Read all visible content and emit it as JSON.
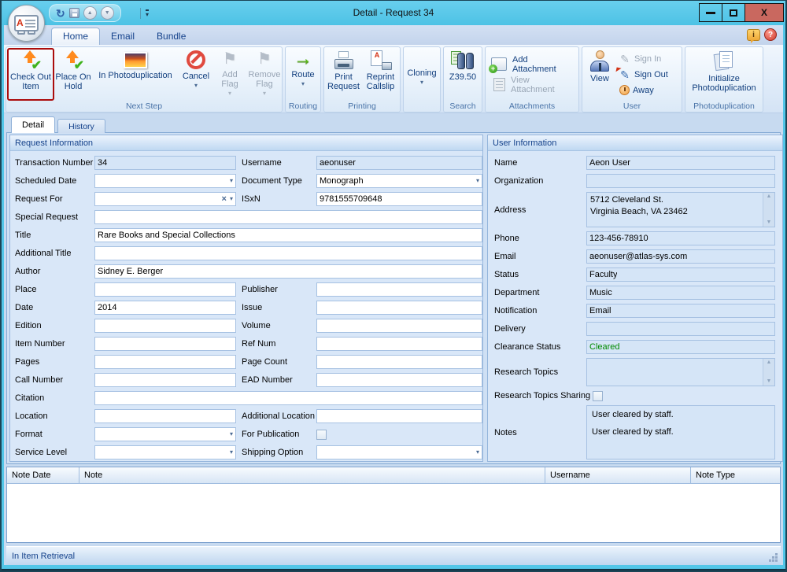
{
  "titlebar": {
    "title": "Detail - Request 34"
  },
  "icons": {
    "dropdown": "▾",
    "clear": "×",
    "check": "✔",
    "flag": "⚑",
    "route_arrow": "→",
    "pencil": "✎",
    "sync": "↻",
    "up": "▲",
    "down": "▼",
    "info": "i",
    "help": "?",
    "close": "X",
    "letter_a": "A",
    "plus": "+"
  },
  "ribbon_tabs": {
    "home": "Home",
    "email": "Email",
    "bundle": "Bundle"
  },
  "ribbon": {
    "next_step": {
      "label": "Next Step",
      "check_out": "Check Out Item",
      "place_hold": "Place On Hold",
      "in_photodup": "In Photoduplication",
      "cancel": "Cancel",
      "add_flag": "Add Flag",
      "remove_flag": "Remove Flag"
    },
    "routing": {
      "label": "Routing",
      "route": "Route"
    },
    "printing": {
      "label": "Printing",
      "print_request": "Print Request",
      "reprint_callslip": "Reprint Callslip"
    },
    "cloning": {
      "label": "",
      "cloning": "Cloning"
    },
    "search": {
      "label": "Search",
      "z3950": "Z39.50"
    },
    "attachments": {
      "label": "Attachments",
      "add": "Add Attachment",
      "view": "View Attachment"
    },
    "user": {
      "label": "User",
      "view": "View",
      "sign_in": "Sign In",
      "sign_out": "Sign Out",
      "away": "Away"
    },
    "photodup": {
      "label": "Photoduplication",
      "initialize": "Initialize Photoduplication"
    }
  },
  "doc_tabs": {
    "detail": "Detail",
    "history": "History"
  },
  "request_info": {
    "header": "Request Information",
    "transaction_number": {
      "label": "Transaction Number",
      "value": "34"
    },
    "username": {
      "label": "Username",
      "value": "aeonuser"
    },
    "scheduled_date": {
      "label": "Scheduled Date",
      "value": ""
    },
    "document_type": {
      "label": "Document Type",
      "value": "Monograph"
    },
    "request_for": {
      "label": "Request For",
      "value": ""
    },
    "isxn": {
      "label": "ISxN",
      "value": "9781555709648"
    },
    "special_request": {
      "label": "Special Request",
      "value": ""
    },
    "title": {
      "label": "Title",
      "value": "Rare Books and Special Collections"
    },
    "additional_title": {
      "label": "Additional Title",
      "value": ""
    },
    "author": {
      "label": "Author",
      "value": "Sidney E. Berger"
    },
    "place": {
      "label": "Place",
      "value": ""
    },
    "publisher": {
      "label": "Publisher",
      "value": ""
    },
    "date": {
      "label": "Date",
      "value": "2014"
    },
    "issue": {
      "label": "Issue",
      "value": ""
    },
    "edition": {
      "label": "Edition",
      "value": ""
    },
    "volume": {
      "label": "Volume",
      "value": ""
    },
    "item_number": {
      "label": "Item Number",
      "value": ""
    },
    "ref_num": {
      "label": "Ref Num",
      "value": ""
    },
    "pages": {
      "label": "Pages",
      "value": ""
    },
    "page_count": {
      "label": "Page Count",
      "value": ""
    },
    "call_number": {
      "label": "Call Number",
      "value": ""
    },
    "ead_number": {
      "label": "EAD Number",
      "value": ""
    },
    "citation": {
      "label": "Citation",
      "value": ""
    },
    "location": {
      "label": "Location",
      "value": ""
    },
    "additional_location": {
      "label": "Additional Location",
      "value": ""
    },
    "format": {
      "label": "Format",
      "value": ""
    },
    "for_publication": {
      "label": "For Publication",
      "checked": false
    },
    "service_level": {
      "label": "Service Level",
      "value": ""
    },
    "shipping_option": {
      "label": "Shipping Option",
      "value": ""
    }
  },
  "user_info": {
    "header": "User Information",
    "name": {
      "label": "Name",
      "value": "Aeon User"
    },
    "organization": {
      "label": "Organization",
      "value": ""
    },
    "address": {
      "label": "Address",
      "value": "5712 Cleveland St.\nVirginia Beach, VA 23462"
    },
    "phone": {
      "label": "Phone",
      "value": "123-456-78910"
    },
    "email": {
      "label": "Email",
      "value": "aeonuser@atlas-sys.com"
    },
    "status": {
      "label": "Status",
      "value": "Faculty"
    },
    "department": {
      "label": "Department",
      "value": "Music"
    },
    "notification": {
      "label": "Notification",
      "value": "Email"
    },
    "delivery": {
      "label": "Delivery",
      "value": ""
    },
    "clearance_status": {
      "label": "Clearance Status",
      "value": "Cleared",
      "color": "#008a00"
    },
    "research_topics": {
      "label": "Research Topics",
      "value": ""
    },
    "research_topics_sharing": {
      "label": "Research Topics Sharing",
      "checked": false
    },
    "notes": {
      "label": "Notes",
      "line1": "User cleared by staff.",
      "line2": "User cleared by staff."
    }
  },
  "notes_table": {
    "note_date": "Note Date",
    "note": "Note",
    "username": "Username",
    "note_type": "Note Type"
  },
  "status_bar": {
    "text": "In Item Retrieval"
  },
  "colors": {
    "titlebar_cyan": "#52c6e8",
    "accent_blue": "#15428b",
    "highlight_border": "#ab0c0c",
    "cleared_green": "#008a00"
  }
}
